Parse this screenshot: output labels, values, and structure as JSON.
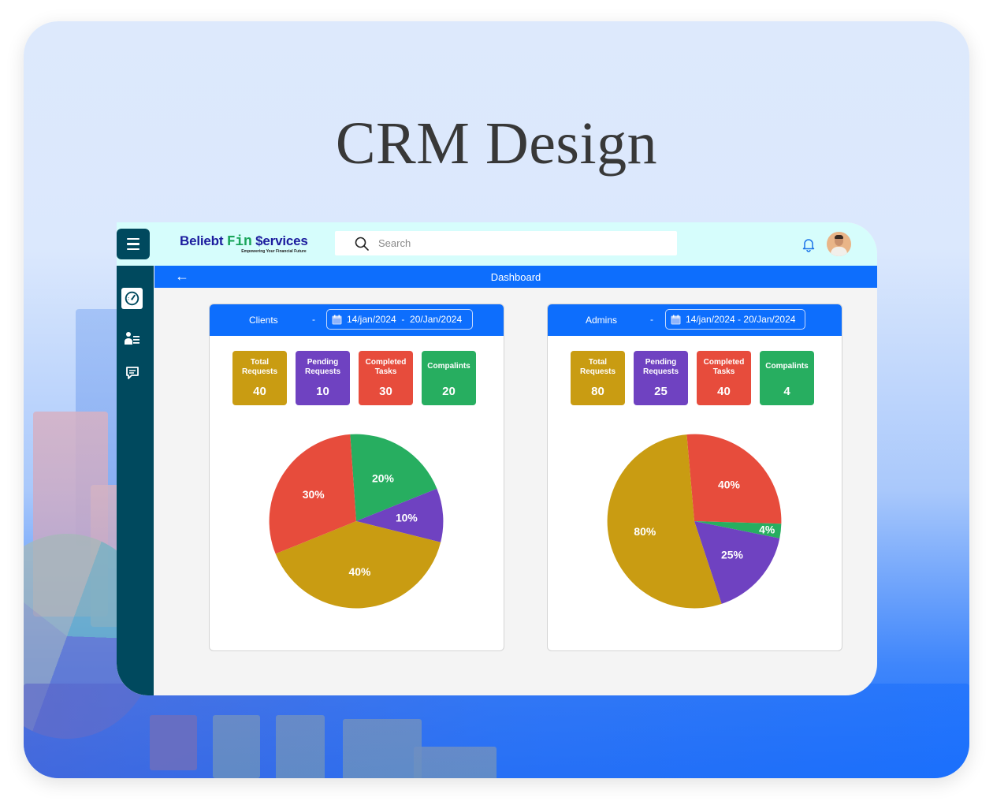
{
  "page": {
    "title": "CRM Design"
  },
  "header": {
    "brand": {
      "part1": "Beliebt",
      "part2": "Fin",
      "part3": "$ervices",
      "tagline": "Empowering Your Financial Future"
    },
    "search_placeholder": "Search",
    "search_value": "",
    "icons": {
      "menu": "hamburger-icon",
      "search": "search-icon",
      "notifications": "bell-icon",
      "avatar": "user-avatar"
    }
  },
  "sidebar": {
    "items": [
      {
        "name": "dashboard",
        "icon": "speedometer-icon",
        "active": true
      },
      {
        "name": "users",
        "icon": "user-list-icon",
        "active": false
      },
      {
        "name": "messages",
        "icon": "chat-icon",
        "active": false
      }
    ]
  },
  "subheader": {
    "back_icon": "arrow-left-icon",
    "back_glyph": "←",
    "title": "Dashboard"
  },
  "colors": {
    "primary": "#0d6efd",
    "sidebar": "#00495e",
    "topbar": "#d6fdfc",
    "gold": "#c99c12",
    "purple": "#6f42c1",
    "red": "#e74c3c",
    "green": "#27ae60"
  },
  "panels": [
    {
      "title": "Clients",
      "separator": "-",
      "date_range": "14/jan/2024  -  20/Jan/2024",
      "stats": [
        {
          "label_line1": "Total",
          "label_line2": "Requests",
          "value": "40",
          "color": "#c99c12"
        },
        {
          "label_line1": "Pending",
          "label_line2": "Requests",
          "value": "10",
          "color": "#6f42c1"
        },
        {
          "label_line1": "Completed",
          "label_line2": "Tasks",
          "value": "30",
          "color": "#e74c3c"
        },
        {
          "label_line1": "Compalints",
          "label_line2": "",
          "value": "20",
          "color": "#27ae60"
        }
      ]
    },
    {
      "title": "Admins",
      "separator": "-",
      "date_range": "14/jan/2024 - 20/Jan/2024",
      "stats": [
        {
          "label_line1": "Total",
          "label_line2": "Requests",
          "value": "80",
          "color": "#c99c12"
        },
        {
          "label_line1": "Pending",
          "label_line2": "Requests",
          "value": "25",
          "color": "#6f42c1"
        },
        {
          "label_line1": "Completed",
          "label_line2": "Tasks",
          "value": "40",
          "color": "#e74c3c"
        },
        {
          "label_line1": "Compalints",
          "label_line2": "",
          "value": "4",
          "color": "#27ae60"
        }
      ]
    }
  ],
  "chart_data": [
    {
      "type": "pie",
      "title": "Clients",
      "start_angle_deg": -4,
      "slices": [
        {
          "name": "Compalints",
          "value": 20,
          "label": "20%",
          "color": "#27ae60"
        },
        {
          "name": "Pending Requests",
          "value": 10,
          "label": "10%",
          "color": "#6f42c1"
        },
        {
          "name": "Total Requests",
          "value": 40,
          "label": "40%",
          "color": "#c99c12"
        },
        {
          "name": "Completed Tasks",
          "value": 30,
          "label": "30%",
          "color": "#e74c3c"
        }
      ]
    },
    {
      "type": "pie",
      "title": "Admins",
      "start_angle_deg": -5,
      "slices": [
        {
          "name": "Completed Tasks",
          "value": 40,
          "label": "40%",
          "color": "#e74c3c"
        },
        {
          "name": "Compalints",
          "value": 4,
          "label": "4%",
          "color": "#27ae60"
        },
        {
          "name": "Pending Requests",
          "value": 25,
          "label": "25%",
          "color": "#6f42c1"
        },
        {
          "name": "Total Requests",
          "value": 80,
          "label": "80%",
          "color": "#c99c12"
        }
      ]
    }
  ]
}
